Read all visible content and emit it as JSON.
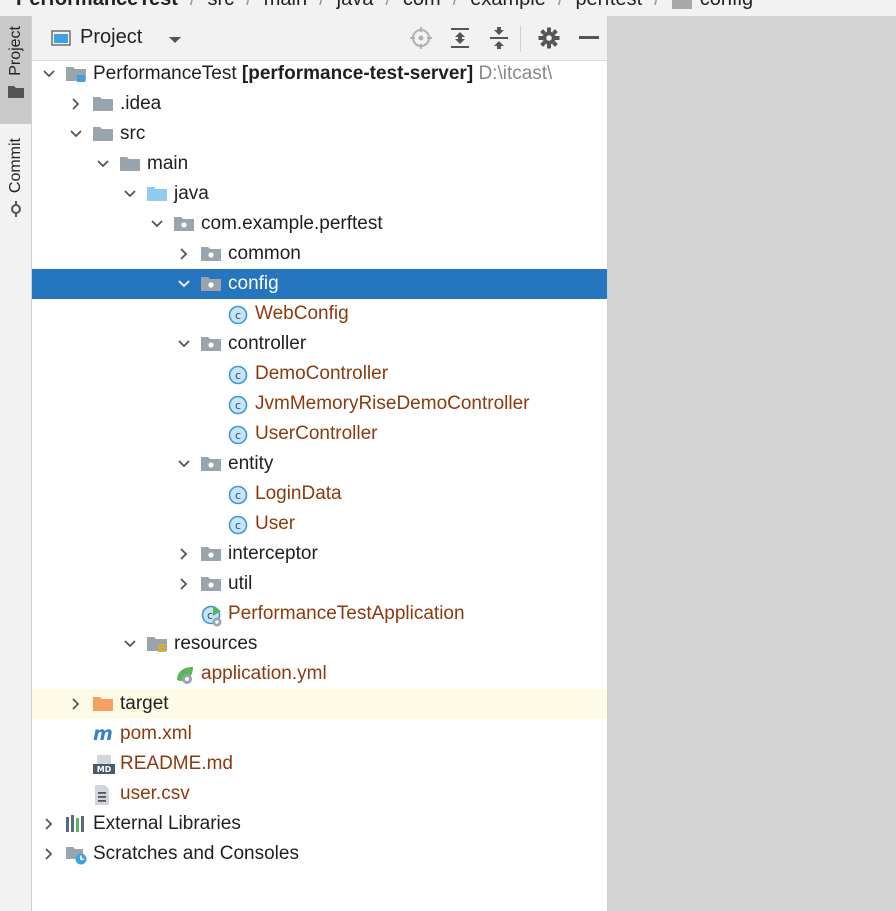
{
  "breadcrumb": [
    "PerformanceTest",
    "src",
    "main",
    "java",
    "com",
    "example",
    "perftest",
    "config"
  ],
  "tool_strip": {
    "project_label": "Project",
    "commit_label": "Commit"
  },
  "header": {
    "title": "Project"
  },
  "colors": {
    "selection": "#2675bf",
    "class_text": "#8c3a0d",
    "highlight_row": "#fdfbe6"
  },
  "tree": [
    {
      "name": "PerformanceTest",
      "module": "[performance-test-server]",
      "path": "D:\\itcast\\",
      "depth": 0,
      "chevron": "down",
      "icon": "module-folder-icon"
    },
    {
      "name": ".idea",
      "depth": 1,
      "chevron": "right",
      "icon": "folder-icon"
    },
    {
      "name": "src",
      "depth": 1,
      "chevron": "down",
      "icon": "folder-icon"
    },
    {
      "name": "main",
      "depth": 2,
      "chevron": "down",
      "icon": "folder-icon"
    },
    {
      "name": "java",
      "depth": 3,
      "chevron": "down",
      "icon": "source-folder-icon"
    },
    {
      "name": "com.example.perftest",
      "depth": 4,
      "chevron": "down",
      "icon": "package-icon"
    },
    {
      "name": "common",
      "depth": 5,
      "chevron": "right",
      "icon": "package-icon"
    },
    {
      "name": "config",
      "depth": 5,
      "chevron": "down",
      "icon": "package-icon",
      "selected": true
    },
    {
      "name": "WebConfig",
      "depth": 6,
      "chevron": "none",
      "icon": "class-icon",
      "type": "class"
    },
    {
      "name": "controller",
      "depth": 5,
      "chevron": "down",
      "icon": "package-icon"
    },
    {
      "name": "DemoController",
      "depth": 6,
      "chevron": "none",
      "icon": "class-icon",
      "type": "class"
    },
    {
      "name": "JvmMemoryRiseDemoController",
      "depth": 6,
      "chevron": "none",
      "icon": "class-icon",
      "type": "class"
    },
    {
      "name": "UserController",
      "depth": 6,
      "chevron": "none",
      "icon": "class-icon",
      "type": "class"
    },
    {
      "name": "entity",
      "depth": 5,
      "chevron": "down",
      "icon": "package-icon"
    },
    {
      "name": "LoginData",
      "depth": 6,
      "chevron": "none",
      "icon": "class-icon",
      "type": "class"
    },
    {
      "name": "User",
      "depth": 6,
      "chevron": "none",
      "icon": "class-icon",
      "type": "class"
    },
    {
      "name": "interceptor",
      "depth": 5,
      "chevron": "right",
      "icon": "package-icon"
    },
    {
      "name": "util",
      "depth": 5,
      "chevron": "right",
      "icon": "package-icon"
    },
    {
      "name": "PerformanceTestApplication",
      "depth": 5,
      "chevron": "none",
      "icon": "spring-boot-class-icon",
      "type": "class"
    },
    {
      "name": "resources",
      "depth": 3,
      "chevron": "down",
      "icon": "resources-folder-icon"
    },
    {
      "name": "application.yml",
      "depth": 4,
      "chevron": "none",
      "icon": "spring-config-icon",
      "type": "class"
    },
    {
      "name": "target",
      "depth": 1,
      "chevron": "right",
      "icon": "excluded-folder-icon",
      "highlight": true
    },
    {
      "name": "pom.xml",
      "depth": 1,
      "chevron": "none",
      "icon": "maven-icon",
      "type": "class"
    },
    {
      "name": "README.md",
      "depth": 1,
      "chevron": "none",
      "icon": "markdown-icon",
      "type": "class"
    },
    {
      "name": "user.csv",
      "depth": 1,
      "chevron": "none",
      "icon": "text-file-icon",
      "type": "class"
    },
    {
      "name": "External Libraries",
      "depth": 0,
      "chevron": "right",
      "icon": "libraries-icon"
    },
    {
      "name": "Scratches and Consoles",
      "depth": 0,
      "chevron": "right",
      "icon": "scratches-icon"
    }
  ]
}
